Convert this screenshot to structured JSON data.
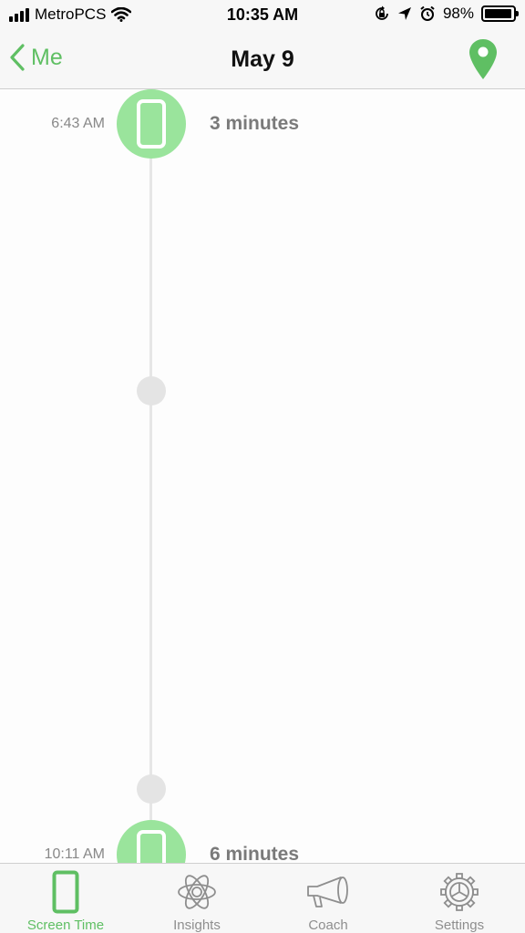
{
  "status_bar": {
    "carrier": "MetroPCS",
    "time": "10:35 AM",
    "battery_percent": "98%",
    "battery_level": 0.98
  },
  "nav": {
    "back_label": "Me",
    "title": "May 9"
  },
  "timeline": {
    "events": [
      {
        "time": "6:43 AM",
        "duration": "3 minutes"
      },
      {
        "time": "10:11 AM",
        "duration": "6 minutes"
      }
    ]
  },
  "tab_bar": {
    "items": [
      {
        "label": "Screen Time",
        "icon": "phone-icon",
        "active": true
      },
      {
        "label": "Insights",
        "icon": "atom-icon",
        "active": false
      },
      {
        "label": "Coach",
        "icon": "megaphone-icon",
        "active": false
      },
      {
        "label": "Settings",
        "icon": "gear-icon",
        "active": false
      }
    ]
  },
  "colors": {
    "accent": "#5fbf63",
    "event_circle": "#9ae49c",
    "timeline": "#e6e6e6"
  }
}
